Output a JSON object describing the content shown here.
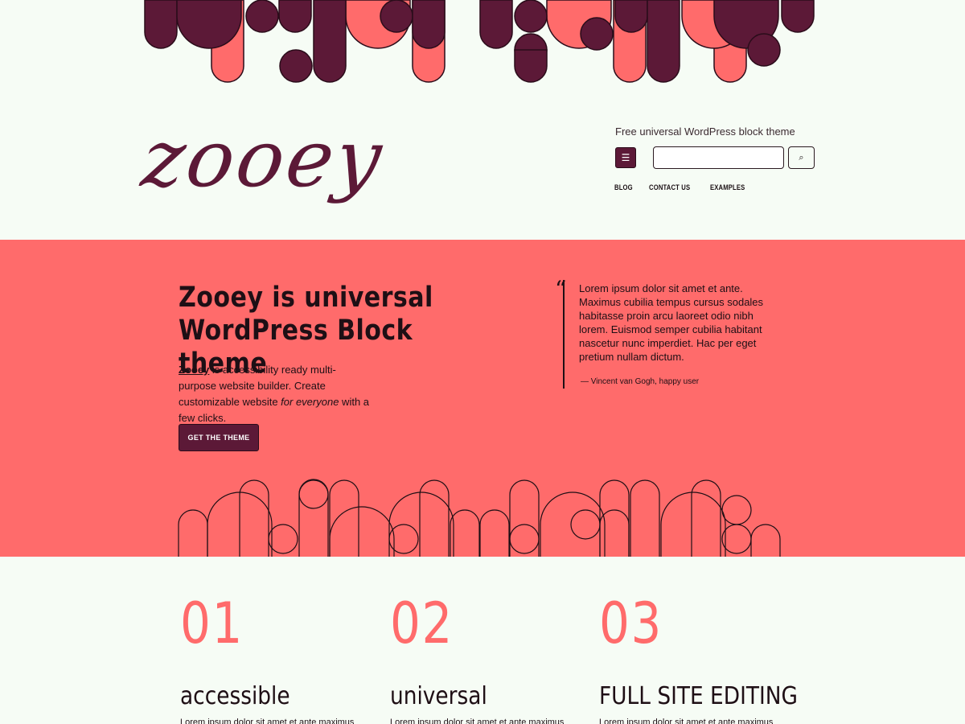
{
  "header": {
    "logo_text": "zooey",
    "tagline": "Free universal WordPress block theme",
    "menu_icon": "☰",
    "search_placeholder": "",
    "search_icon": "⌕",
    "nav": [
      "BLOG",
      "CONTACT US",
      "EXAMPLES"
    ]
  },
  "hero": {
    "title": "Zooey is universal WordPress Block theme",
    "text_brand": "Zooey",
    "text_part1": " is accessibility ready multi-purpose website builder. Create customizable website ",
    "text_em": "for everyone",
    "text_part2": " with a few clicks.",
    "cta_label": "GET THE THEME",
    "quote_text": "Lorem ipsum dolor sit amet et ante. Maximus cubilia tempus cursus sodales habitasse proin arcu laoreet odio nibh lorem. Euismod semper cubilia habitant nascetur nunc imperdiet. Hac per eget pretium nullam dictum.",
    "quote_cite": "— Vincent van Gogh, happy user"
  },
  "features": [
    {
      "num": "01",
      "title": "accessible",
      "text": "Lorem ipsum dolor sit amet et ante maximus cubilia tempus cursus"
    },
    {
      "num": "02",
      "title": "universal",
      "text": "Lorem ipsum dolor sit amet et ante maximus cubilia tempus cursus"
    },
    {
      "num": "03",
      "title": "FULL SITE EDITING",
      "text": "Lorem ipsum dolor sit amet et ante maximus cubilia tempus cursus"
    }
  ],
  "colors": {
    "coral": "#ff6b6b",
    "plum": "#5c1937",
    "background": "#f6fcf5",
    "ink": "#1e0f15"
  }
}
